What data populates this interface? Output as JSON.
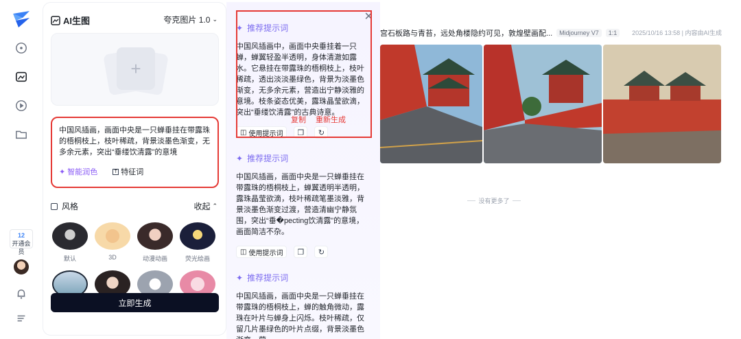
{
  "rail": {
    "vip_count": "12",
    "vip_label": "开通会员"
  },
  "panel": {
    "title": "AI生图",
    "model": "夸克图片 1.0",
    "prompt": "中国风插画，画面中央是一只蝉垂挂在带露珠的梧桐枝上，枝叶稀疏，背景淡墨色渐变，无多余元素，突出“垂缕饮清露”的意境",
    "tool_smart": "智能润色",
    "tool_keywords": "特征词",
    "style_title": "风格",
    "collapse": "收起",
    "styles": [
      "默认",
      "3D",
      "动漫动画",
      "荧光绘画"
    ],
    "generate": "立即生成"
  },
  "suggestions": {
    "title": "推荐提示词",
    "copy": "复制",
    "regenerate": "重新生成",
    "use_label": "使用提示词",
    "items": [
      "中国风插画中，画面中央垂挂着一只蝉，蝉翼轻盈半透明，身体清澈如露水。它悬挂在带露珠的梧桐枝上，枝叶稀疏，透出淡淡墨绿色，背景为淡墨色渐变，无多余元素，营造出宁静淡雅的意境。枝条姿态优美，露珠晶莹欲滴，突出“垂缕饮清露”的古典诗意。",
      "中国风插画，画面中央是一只蝉垂挂在带露珠的梧桐枝上，蝉翼透明半透明，露珠晶莹欲滴，枝叶稀疏笔墨淡雅，背景淡墨色渐变过渡，营造清幽宁静氛围，突出“垂�pecting饮清露”的意境，画面简洁不杂。",
      "中国风插画，画面中央是一只蝉垂挂在带露珠的梧桐枝上，蝉的触角微动，露珠在叶片与蝉身上闪烁。枝叶稀疏，仅留几片墨绿色的叶片点缀，背景淡墨色渐变，营"
    ]
  },
  "results": {
    "prompt_excerpt": "宫石板路与青苔，远处角楼隐约可见，敦煌壁画配...",
    "model_tag": "Midjourney V7",
    "ratio_tag": "1:1",
    "meta": "2025/10/16 13:58 | 内容由AI生成",
    "no_more": "没有更多了"
  },
  "colors": {
    "accent_red": "#e53935",
    "purple": "#7c6cf0",
    "dark_button": "#0b1023"
  }
}
